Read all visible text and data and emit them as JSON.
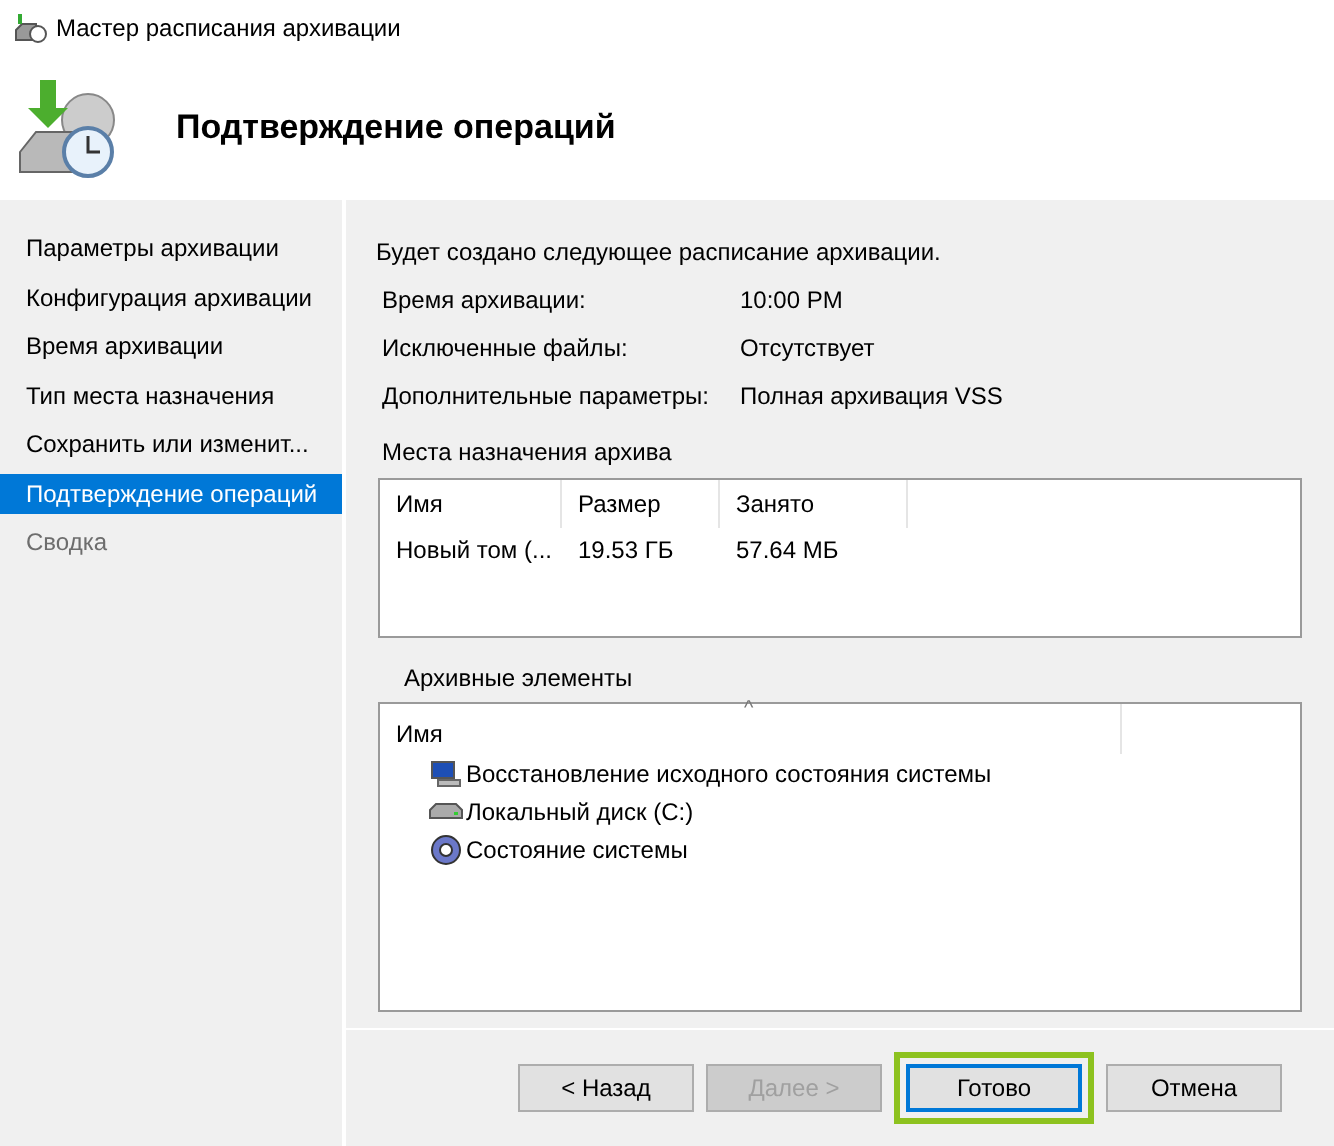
{
  "window": {
    "title": "Мастер расписания архивации"
  },
  "header": {
    "title": "Подтверждение операций"
  },
  "sidebar": {
    "items": [
      {
        "label": "Параметры архивации",
        "selected": false,
        "disabled": false
      },
      {
        "label": "Конфигурация архивации",
        "selected": false,
        "disabled": false
      },
      {
        "label": "Время архивации",
        "selected": false,
        "disabled": false
      },
      {
        "label": "Тип места назначения",
        "selected": false,
        "disabled": false
      },
      {
        "label": "Сохранить или изменит...",
        "selected": false,
        "disabled": false
      },
      {
        "label": "Подтверждение операций",
        "selected": true,
        "disabled": false
      },
      {
        "label": "Сводка",
        "selected": false,
        "disabled": true
      }
    ]
  },
  "summary": {
    "intro": "Будет создано следующее расписание архивации.",
    "rows": [
      {
        "label": "Время архивации:",
        "value": "10:00 PM"
      },
      {
        "label": "Исключенные файлы:",
        "value": "Отсутствует"
      },
      {
        "label": "Дополнительные параметры:",
        "value": "Полная архивация VSS"
      }
    ]
  },
  "destinations": {
    "title": "Места назначения архива",
    "columns": [
      "Имя",
      "Размер",
      "Занято"
    ],
    "rows": [
      [
        "Новый том (...",
        "19.53 ГБ",
        "57.64 МБ"
      ]
    ]
  },
  "items": {
    "title": "Архивные элементы",
    "column": "Имя",
    "sort_glyph": "^",
    "rows": [
      {
        "kind": "restore",
        "label": "Восстановление исходного состояния системы"
      },
      {
        "kind": "disk",
        "label": "Локальный диск (C:)"
      },
      {
        "kind": "state",
        "label": "Состояние системы"
      }
    ]
  },
  "buttons": [
    {
      "label": "< Назад",
      "disabled": false,
      "highlighted": false
    },
    {
      "label": "Далее >",
      "disabled": true,
      "highlighted": false
    },
    {
      "label": "Готово",
      "disabled": false,
      "highlighted": true
    },
    {
      "label": "Отмена",
      "disabled": false,
      "highlighted": false
    }
  ]
}
